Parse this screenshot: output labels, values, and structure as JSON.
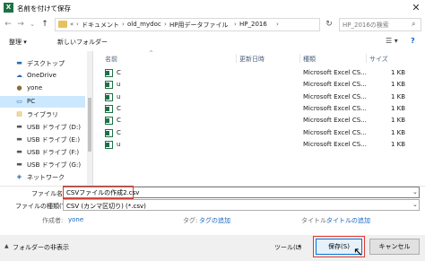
{
  "window": {
    "title": "名前を付けて保存",
    "app_icon": "X",
    "close": "✕"
  },
  "nav": {
    "back": "←",
    "forward": "→",
    "up_history": "⌄",
    "up": "↑",
    "breadcrumbs": [
      "ドキュメント",
      "old_mydoc",
      "HP用データファイル",
      "HP_2016"
    ],
    "crumb_prefix": "«",
    "separator": "›",
    "refresh": "↻",
    "search_placeholder": "HP_2016の検索",
    "search_icon": "⌕"
  },
  "toolbar": {
    "organize": "整理 ▾",
    "new_folder": "新しいフォルダー",
    "view": "☰ ▾",
    "help": "?"
  },
  "sidebar": {
    "items": [
      {
        "icon": "desktop-icon",
        "glyph": "▬",
        "color": "#2b6cb0",
        "label": "デスクトップ",
        "selected": false
      },
      {
        "icon": "onedrive-icon",
        "glyph": "☁",
        "color": "#2b6cb0",
        "label": "OneDrive",
        "selected": false
      },
      {
        "icon": "user-icon",
        "glyph": "●",
        "color": "#8a6d3b",
        "label": "yone",
        "selected": false
      },
      {
        "icon": "pc-icon",
        "glyph": "▭",
        "color": "#2b6cb0",
        "label": "PC",
        "selected": true
      },
      {
        "icon": "library-icon",
        "glyph": "▤",
        "color": "#d4a017",
        "label": "ライブラリ",
        "selected": false
      },
      {
        "icon": "usb-drive-icon",
        "glyph": "▬",
        "color": "#555555",
        "label": "USB ドライブ (D:)",
        "selected": false
      },
      {
        "icon": "usb-drive-icon",
        "glyph": "▬",
        "color": "#555555",
        "label": "USB ドライブ (E:)",
        "selected": false
      },
      {
        "icon": "usb-drive-icon",
        "glyph": "▬",
        "color": "#555555",
        "label": "USB ドライブ (F:)",
        "selected": false
      },
      {
        "icon": "usb-drive-icon",
        "glyph": "▬",
        "color": "#555555",
        "label": "USB ドライブ (G:)",
        "selected": false
      },
      {
        "icon": "network-icon",
        "glyph": "◈",
        "color": "#2b6cb0",
        "label": "ネットワーク",
        "selected": false
      }
    ]
  },
  "filelist": {
    "headers": {
      "name": "名前",
      "sort_arrow": "^",
      "modified": "更新日時",
      "type": "種類",
      "size": "サイズ"
    },
    "rows": [
      {
        "name": "C",
        "type": "Microsoft Excel CS...",
        "size": "1 KB"
      },
      {
        "name": "u",
        "type": "Microsoft Excel CS...",
        "size": "1 KB"
      },
      {
        "name": "u",
        "type": "Microsoft Excel CS...",
        "size": "1 KB"
      },
      {
        "name": "C",
        "type": "Microsoft Excel CS...",
        "size": "1 KB"
      },
      {
        "name": "C",
        "type": "Microsoft Excel CS...",
        "size": "1 KB"
      },
      {
        "name": "C",
        "type": "Microsoft Excel CS...",
        "size": "1 KB"
      },
      {
        "name": "u",
        "type": "Microsoft Excel CS...",
        "size": "1 KB"
      }
    ]
  },
  "form": {
    "filename_label": "ファイル名(N):",
    "filename_value": "CSVファイルの作成2.csv",
    "filetype_label": "ファイルの種類(T):",
    "filetype_value": "CSV (カンマ区切り) (*.csv)",
    "dropdown_arrow": "⌄"
  },
  "meta": {
    "author_label": "作成者:",
    "author_value": "yone",
    "tags_label": "タグ:",
    "tags_value": "タグの追加",
    "title_label": "タイトル:",
    "title_value": "タイトルの追加"
  },
  "footer": {
    "hide_folders": "フォルダーの非表示",
    "hide_icon": "▲",
    "tools": "ツール(L)",
    "tools_arrow": "▾",
    "save": "保存(S)",
    "cancel": "キャンセル",
    "cursor": "↖"
  },
  "colors": {
    "accent": "#0078d7",
    "highlight": "#e2382f",
    "excel": "#1e7145",
    "selected": "#cce8ff"
  }
}
